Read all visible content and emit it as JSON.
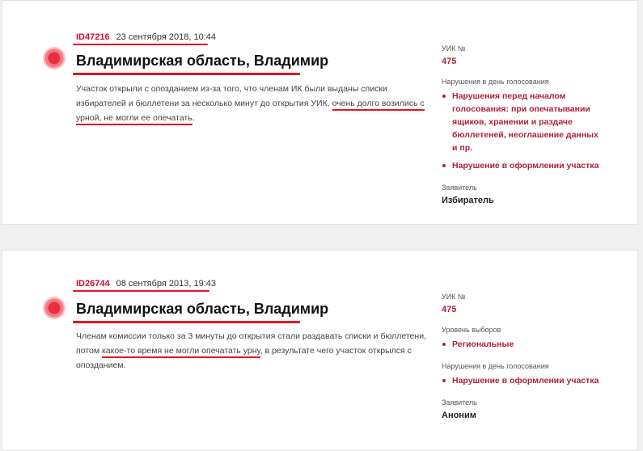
{
  "colors": {
    "accent": "#e3141f",
    "link": "#b0203a",
    "id": "#c8102e"
  },
  "cards": [
    {
      "id": "ID47216",
      "date": "23 сентября 2018, 10:44",
      "title": "Владимирская область, Владимир",
      "desc_before": "Участок открыли с опозданием из-за того, что членам ИК были выданы списки избирателей и бюллетени за несколько минут до открытия УИК, ",
      "desc_highlight": "очень долго возились с урной, не могли ее опечатать",
      "desc_after": ".",
      "uik_label": "УИК №",
      "uik_value": "475",
      "violations_label": "Нарушения в день голосования",
      "violations": [
        "Нарушения перед началом голосования: при опечатывании ящиков, хранении и раздаче бюллетеней, неоглашение данных и пр.",
        "Нарушение в оформлении участка"
      ],
      "applicant_label": "Заявитель",
      "applicant_value": "Избиратель"
    },
    {
      "id": "ID26744",
      "date": "08 сентября 2013, 19:43",
      "title": "Владимирская область, Владимир",
      "desc_before": "Членам комиссии только за 3 минуты до открытия стали раздавать списки и бюллетени, потом ",
      "desc_highlight": "какое-то время не могли опечатать урну",
      "desc_after": ", в результате чего участок открылся с опозданием.",
      "uik_label": "УИК №",
      "uik_value": "475",
      "level_label": "Уровень выборов",
      "level_value": "Региональные",
      "violations_label": "Нарушения в день голосования",
      "violations": [
        "Нарушение в оформлении участка"
      ],
      "applicant_label": "Заявитель",
      "applicant_value": "Аноним"
    }
  ]
}
